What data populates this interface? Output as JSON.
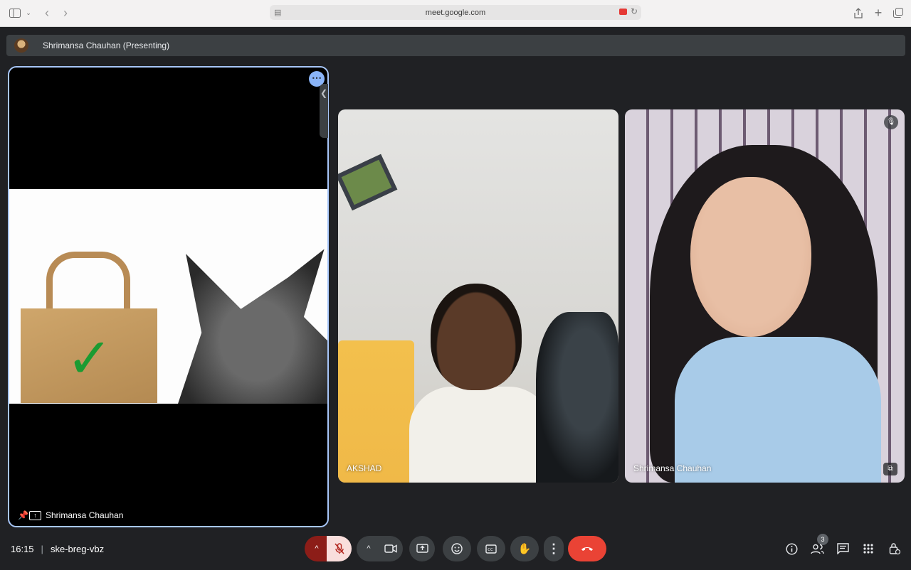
{
  "browser": {
    "url": "meet.google.com"
  },
  "presenting": {
    "label": "Shrimansa Chauhan (Presenting)"
  },
  "tiles": {
    "presentation": {
      "name": "Shrimansa Chauhan"
    },
    "participant_1": {
      "name": "AKSHAD"
    },
    "participant_2": {
      "name": "Shrimansa Chauhan"
    }
  },
  "controls": {
    "time": "16:15",
    "separator": "|",
    "meeting_code": "ske-breg-vbz",
    "people_count": "3"
  },
  "colors": {
    "background": "#202124",
    "accent_border": "#a8c7fa",
    "end_call": "#ea4335",
    "mic_off_bg": "#f9dedc"
  },
  "icons": [
    "sidebar-icon",
    "back-icon",
    "forward-icon",
    "page-icon",
    "camera-icon",
    "reload-icon",
    "share-icon",
    "new-tab-icon",
    "tabs-icon",
    "more-icon",
    "pin-icon",
    "present-icon",
    "mic-off-icon",
    "chevron-up-icon",
    "camera-video-icon",
    "present-screen-icon",
    "emoji-icon",
    "captions-icon",
    "raise-hand-icon",
    "more-vert-icon",
    "end-call-icon",
    "info-icon",
    "people-icon",
    "chat-icon",
    "apps-icon",
    "host-controls-icon",
    "pip-icon"
  ]
}
